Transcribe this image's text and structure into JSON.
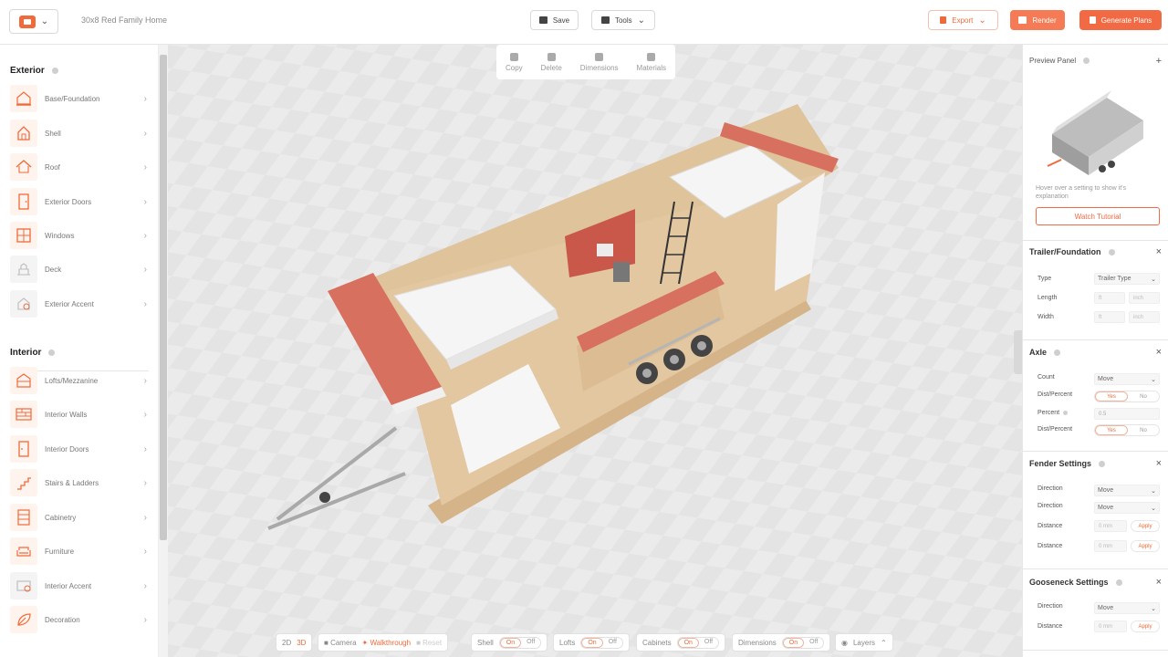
{
  "app": {
    "project_title": "30x8 Red Family Home"
  },
  "toolbar": {
    "save_label": "Save",
    "tools_label": "Tools",
    "export_label": "Export",
    "render_label": "Render",
    "generate_label": "Generate Plans"
  },
  "edit_bar": {
    "copy": "Copy",
    "delete": "Delete",
    "dimensions": "Dimensions",
    "materials": "Materials"
  },
  "sidebar": {
    "exterior_title": "Exterior",
    "exterior_items": [
      {
        "label": "Base/Foundation",
        "icon": "foundation-icon"
      },
      {
        "label": "Shell",
        "icon": "shell-icon"
      },
      {
        "label": "Roof",
        "icon": "roof-icon"
      },
      {
        "label": "Exterior Doors",
        "icon": "door-icon"
      },
      {
        "label": "Windows",
        "icon": "window-icon"
      },
      {
        "label": "Deck",
        "icon": "deck-icon"
      },
      {
        "label": "Exterior Accent",
        "icon": "accent-icon"
      }
    ],
    "interior_title": "Interior",
    "interior_items": [
      {
        "label": "Lofts/Mezzanine",
        "icon": "loft-icon"
      },
      {
        "label": "Interior Walls",
        "icon": "wall-icon"
      },
      {
        "label": "Interior Doors",
        "icon": "door-icon"
      },
      {
        "label": "Stairs & Ladders",
        "icon": "stairs-icon"
      },
      {
        "label": "Cabinetry",
        "icon": "cabinet-icon"
      },
      {
        "label": "Furniture",
        "icon": "sofa-icon"
      },
      {
        "label": "Interior Accent",
        "icon": "accent-icon"
      },
      {
        "label": "Decoration",
        "icon": "leaf-icon"
      }
    ]
  },
  "bottom": {
    "view_2d": "2D",
    "view_3d": "3D",
    "camera": "Camera",
    "walkthrough": "Walkthrough",
    "reset": "Reset",
    "shell": "Shell",
    "lofts": "Lofts",
    "cabinets": "Cabinets",
    "dimensions": "Dimensions",
    "layers": "Layers",
    "on": "On",
    "off": "Off"
  },
  "preview": {
    "title": "Preview Panel",
    "hint": "Hover over a setting to show it's explanation",
    "tutorial": "Watch Tutorial"
  },
  "trailer": {
    "title": "Trailer/Foundation",
    "type_label": "Type",
    "type_value": "Trailer Type",
    "length_label": "Length",
    "width_label": "Width",
    "ft": "ft",
    "inch": "inch"
  },
  "axle": {
    "title": "Axle",
    "count_label": "Count",
    "count_value": "Move",
    "dist_label": "Dist/Percent",
    "percent_label": "Percent",
    "percent_value": "0.5",
    "yes": "Yes",
    "no": "No"
  },
  "fender": {
    "title": "Fender Settings",
    "direction_label": "Direction",
    "direction_value": "Move",
    "distance_label": "Distance",
    "mm": "0 mm",
    "apply": "Apply"
  },
  "gooseneck": {
    "title": "Gooseneck Settings",
    "direction_label": "Direction",
    "direction_value": "Move",
    "distance_label": "Distance",
    "mm": "0 mm",
    "apply": "Apply"
  },
  "colors": {
    "accent": "#f26a43",
    "wood": "#dcc3a0",
    "red_panel": "#d8705f"
  }
}
